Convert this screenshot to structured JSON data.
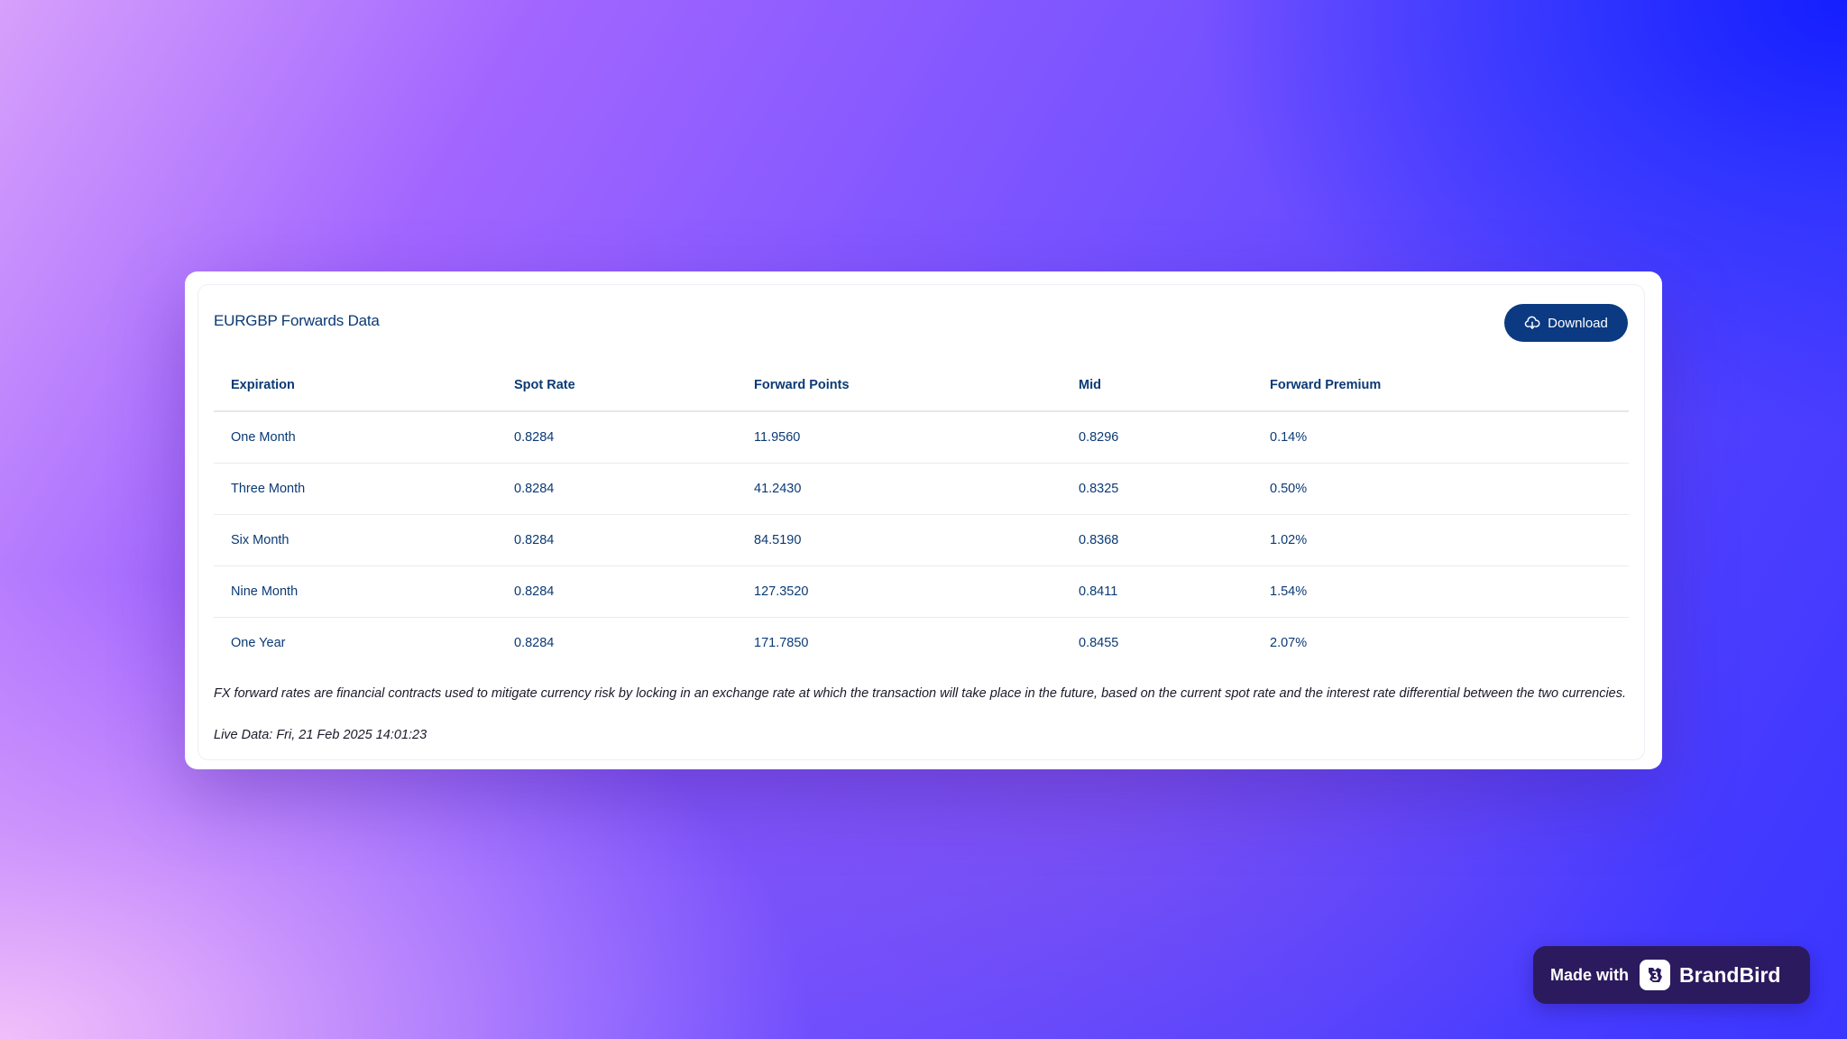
{
  "card": {
    "title": "EURGBP Forwards Data",
    "download_label": "Download",
    "download_icon": "cloud-download-icon"
  },
  "table": {
    "headers": [
      "Expiration",
      "Spot Rate",
      "Forward Points",
      "Mid",
      "Forward Premium"
    ],
    "rows": [
      [
        "One Month",
        "0.8284",
        "11.9560",
        "0.8296",
        "0.14%"
      ],
      [
        "Three Month",
        "0.8284",
        "41.2430",
        "0.8325",
        "0.50%"
      ],
      [
        "Six Month",
        "0.8284",
        "84.5190",
        "0.8368",
        "1.02%"
      ],
      [
        "Nine Month",
        "0.8284",
        "127.3520",
        "0.8411",
        "1.54%"
      ],
      [
        "One Year",
        "0.8284",
        "171.7850",
        "0.8455",
        "2.07%"
      ]
    ]
  },
  "footnote": "FX forward rates are financial contracts used to mitigate currency risk by locking in an exchange rate at which the transaction will take place in the future, based on the current spot rate and the interest rate differential between the two currencies.",
  "live_data": "Live Data: Fri, 21 Feb 2025 14:01:23",
  "badge": {
    "made_with": "Made with",
    "brand": "BrandBird",
    "logo_icon": "brandbird-logo-icon"
  },
  "colors": {
    "primary_navy": "#0b3a82",
    "text_navy": "#0b3a75",
    "badge_bg": "#2c1a5e"
  }
}
